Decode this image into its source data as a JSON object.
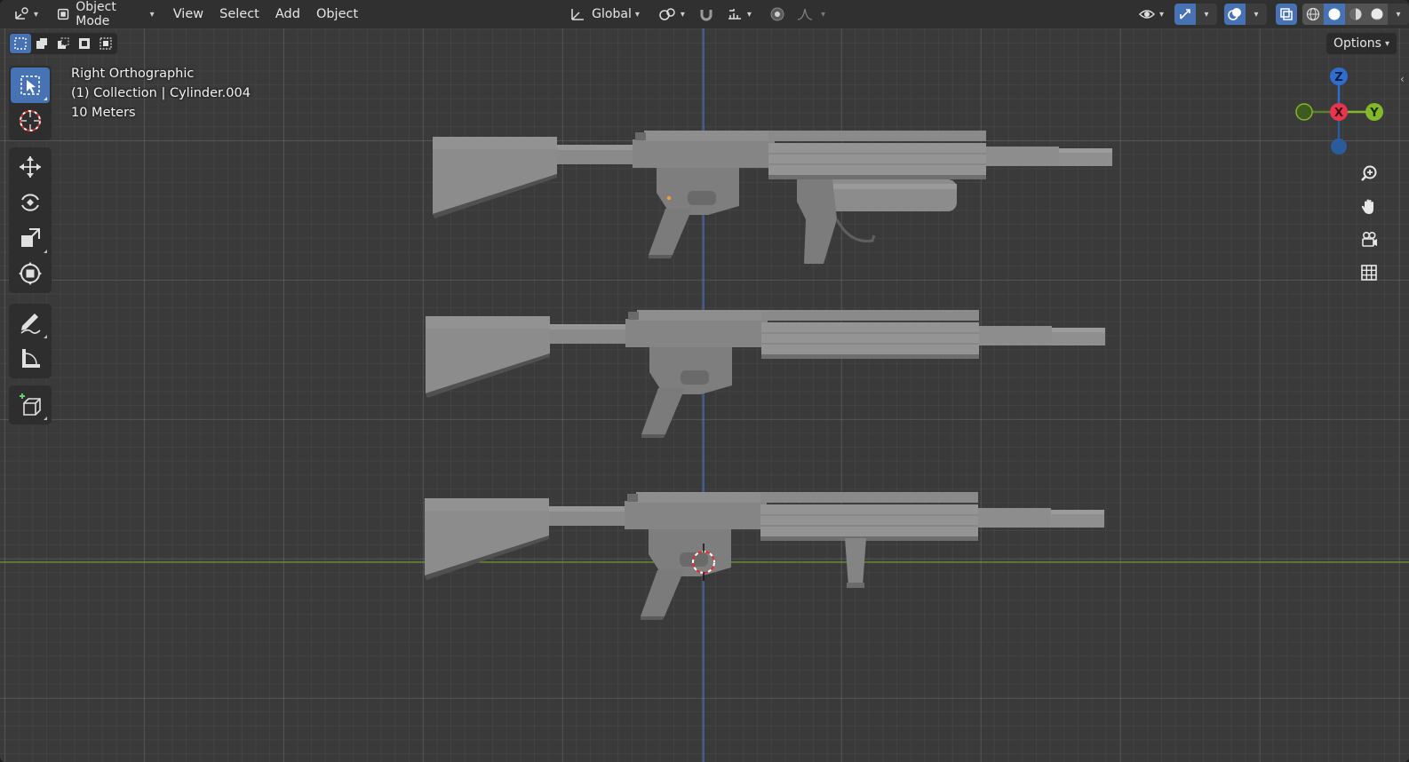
{
  "header": {
    "mode": "Object Mode",
    "menus": [
      "View",
      "Select",
      "Add",
      "Object"
    ],
    "transform_orientation": "Global",
    "options_label": "Options"
  },
  "overlay": {
    "view_name": "Right Orthographic",
    "collection_info": "(1) Collection | Cylinder.004",
    "scale_info": "10 Meters"
  },
  "gizmo": {
    "z_label": "Z",
    "x_label": "X",
    "y_label": "Y",
    "colors": {
      "z": "#2f6dd0",
      "x": "#e8354f",
      "y": "#82b829",
      "neg_y": "#5a7f2a",
      "neg_z": "#2a5c9c"
    }
  },
  "toolbar": {
    "tools": [
      "select-box",
      "cursor",
      "move",
      "rotate",
      "scale",
      "transform",
      "annotate",
      "measure",
      "add-cube"
    ],
    "active_tool": "select-box"
  },
  "colors": {
    "accent": "#4772b3",
    "x_axis_line": "#6f9a2e",
    "z_axis_line": "#3f6fcc",
    "model": "#8a8a8a"
  }
}
